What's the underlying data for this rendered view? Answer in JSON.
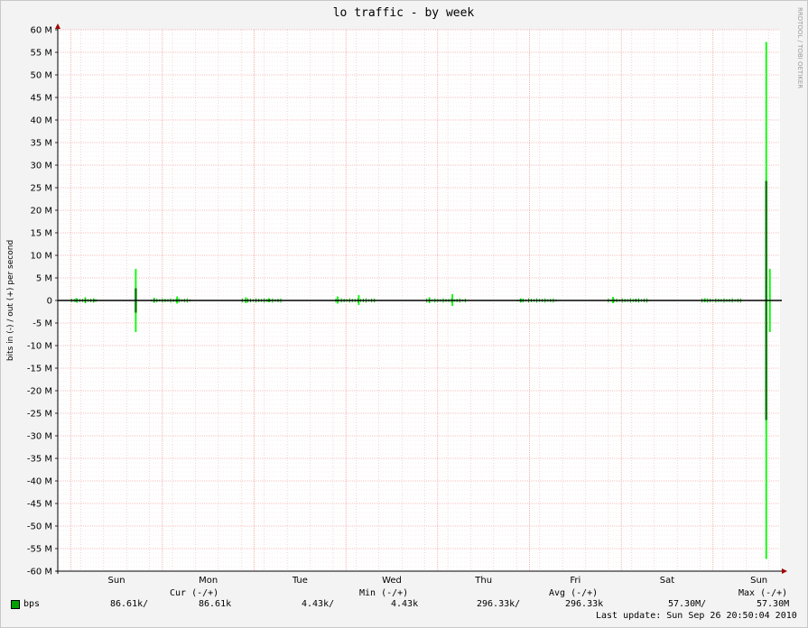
{
  "chart_data": {
    "type": "area",
    "title": "lo traffic - by week",
    "ylabel": "bits in (-) / out (+) per second",
    "watermark": "RRDTOOL / TOBI OETIKER",
    "ylim": [
      -60000000,
      60000000
    ],
    "yticks": [
      {
        "v": 60000000,
        "label": "60 M"
      },
      {
        "v": 55000000,
        "label": "55 M"
      },
      {
        "v": 50000000,
        "label": "50 M"
      },
      {
        "v": 45000000,
        "label": "45 M"
      },
      {
        "v": 40000000,
        "label": "40 M"
      },
      {
        "v": 35000000,
        "label": "35 M"
      },
      {
        "v": 30000000,
        "label": "30 M"
      },
      {
        "v": 25000000,
        "label": "25 M"
      },
      {
        "v": 20000000,
        "label": "20 M"
      },
      {
        "v": 15000000,
        "label": "15 M"
      },
      {
        "v": 10000000,
        "label": "10 M"
      },
      {
        "v": 5000000,
        "label": "5 M"
      },
      {
        "v": 0,
        "label": "0"
      },
      {
        "v": -5000000,
        "label": "-5 M"
      },
      {
        "v": -10000000,
        "label": "-10 M"
      },
      {
        "v": -15000000,
        "label": "-15 M"
      },
      {
        "v": -20000000,
        "label": "-20 M"
      },
      {
        "v": -25000000,
        "label": "-25 M"
      },
      {
        "v": -30000000,
        "label": "-30 M"
      },
      {
        "v": -35000000,
        "label": "-35 M"
      },
      {
        "v": -40000000,
        "label": "-40 M"
      },
      {
        "v": -45000000,
        "label": "-45 M"
      },
      {
        "v": -50000000,
        "label": "-50 M"
      },
      {
        "v": -55000000,
        "label": "-55 M"
      },
      {
        "v": -60000000,
        "label": "-60 M"
      }
    ],
    "x_days": [
      "Sun",
      "Mon",
      "Tue",
      "Wed",
      "Thu",
      "Fri",
      "Sat",
      "Sun"
    ],
    "x_range_days": [
      0,
      7.87
    ],
    "series": [
      {
        "name": "bps",
        "color": "#00ff00",
        "color_dark": "#008000",
        "points": [
          {
            "x": 0.2,
            "out": 500000,
            "in": -400000
          },
          {
            "x": 0.3,
            "out": 700000,
            "in": -600000
          },
          {
            "x": 0.4,
            "out": 300000,
            "in": -300000
          },
          {
            "x": 0.85,
            "out": 7000000,
            "in": -7000000
          },
          {
            "x": 0.85,
            "out": 2700000,
            "in": -2700000
          },
          {
            "x": 1.05,
            "out": 600000,
            "in": -500000
          },
          {
            "x": 1.3,
            "out": 900000,
            "in": -700000
          },
          {
            "x": 2.05,
            "out": 700000,
            "in": -600000
          },
          {
            "x": 2.3,
            "out": 500000,
            "in": -400000
          },
          {
            "x": 3.05,
            "out": 900000,
            "in": -700000
          },
          {
            "x": 3.28,
            "out": 1200000,
            "in": -1000000
          },
          {
            "x": 4.05,
            "out": 700000,
            "in": -600000
          },
          {
            "x": 4.3,
            "out": 1400000,
            "in": -1200000
          },
          {
            "x": 5.05,
            "out": 400000,
            "in": -400000
          },
          {
            "x": 6.05,
            "out": 800000,
            "in": -600000
          },
          {
            "x": 6.3,
            "out": 400000,
            "in": -300000
          },
          {
            "x": 7.05,
            "out": 500000,
            "in": -400000
          },
          {
            "x": 7.72,
            "out": 57300000,
            "in": -57300000
          },
          {
            "x": 7.72,
            "out": 26500000,
            "in": -26500000
          },
          {
            "x": 7.76,
            "out": 7000000,
            "in": -7000000
          }
        ]
      }
    ],
    "legend": {
      "headers": {
        "cur": "Cur (-/+)",
        "min": "Min (-/+)",
        "avg": "Avg (-/+)",
        "max": "Max (-/+)"
      },
      "label": "bps",
      "cur_in": "86.61k/",
      "cur_out": "86.61k",
      "min_in": "4.43k/",
      "min_out": "4.43k",
      "avg_in": "296.33k/",
      "avg_out": "296.33k",
      "max_in": "57.30M/",
      "max_out": "57.30M"
    },
    "last_update": "Last update: Sun Sep 26 20:50:04 2010"
  }
}
